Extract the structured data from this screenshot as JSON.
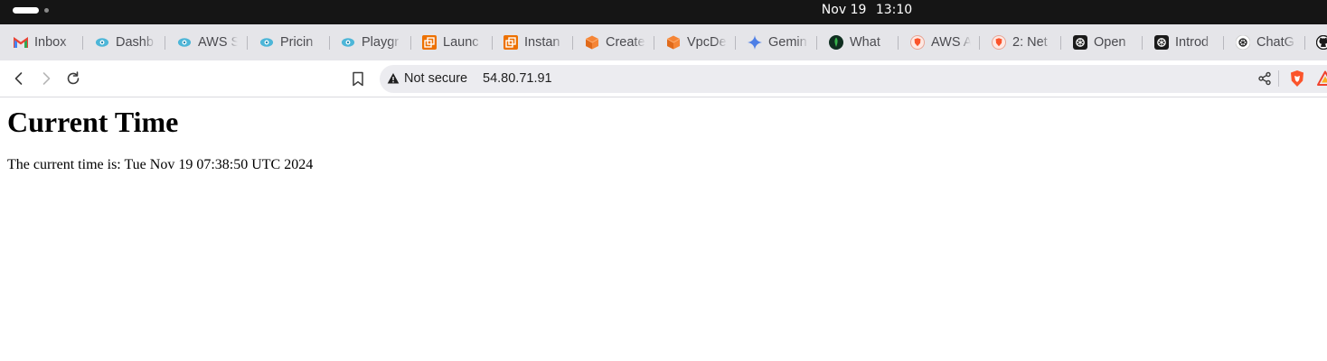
{
  "os": {
    "date": "Nov 19",
    "time": "13:10"
  },
  "bookmarks": [
    {
      "label": "Inbox",
      "icon": "gmail-icon"
    },
    {
      "label": "Dashb",
      "icon": "cloud-eye-icon"
    },
    {
      "label": "AWS S",
      "icon": "cloud-eye-icon"
    },
    {
      "label": "Pricin",
      "icon": "cloud-eye-icon"
    },
    {
      "label": "Playgr",
      "icon": "cloud-eye-icon"
    },
    {
      "label": "Launc",
      "icon": "aws-ec2-icon"
    },
    {
      "label": "Instan",
      "icon": "aws-ec2-icon"
    },
    {
      "label": "Create",
      "icon": "aws-cube-icon"
    },
    {
      "label": "VpcDe",
      "icon": "aws-cube-icon"
    },
    {
      "label": "Gemin",
      "icon": "gemini-sparkle-icon"
    },
    {
      "label": "What",
      "icon": "mongodb-leaf-icon"
    },
    {
      "label": "AWS A",
      "icon": "brave-shield-icon"
    },
    {
      "label": "2: Net",
      "icon": "brave-shield-icon"
    },
    {
      "label": "Open",
      "icon": "openai-icon"
    },
    {
      "label": "Introd",
      "icon": "openai-icon"
    },
    {
      "label": "ChatG",
      "icon": "openai-icon"
    },
    {
      "label": "",
      "icon": "github-icon"
    }
  ],
  "toolbar": {
    "security_label": "Not secure",
    "url": "54.80.71.91"
  },
  "page": {
    "heading": "Current Time",
    "body": "The current time is: Tue Nov 19 07:38:50 UTC 2024"
  },
  "colors": {
    "os_bar": "#151515",
    "bookmarks_bar": "#e5e5e9",
    "url_box": "#ececf0",
    "aws_orange": "#f58536",
    "brave_orange": "#fb542b"
  }
}
